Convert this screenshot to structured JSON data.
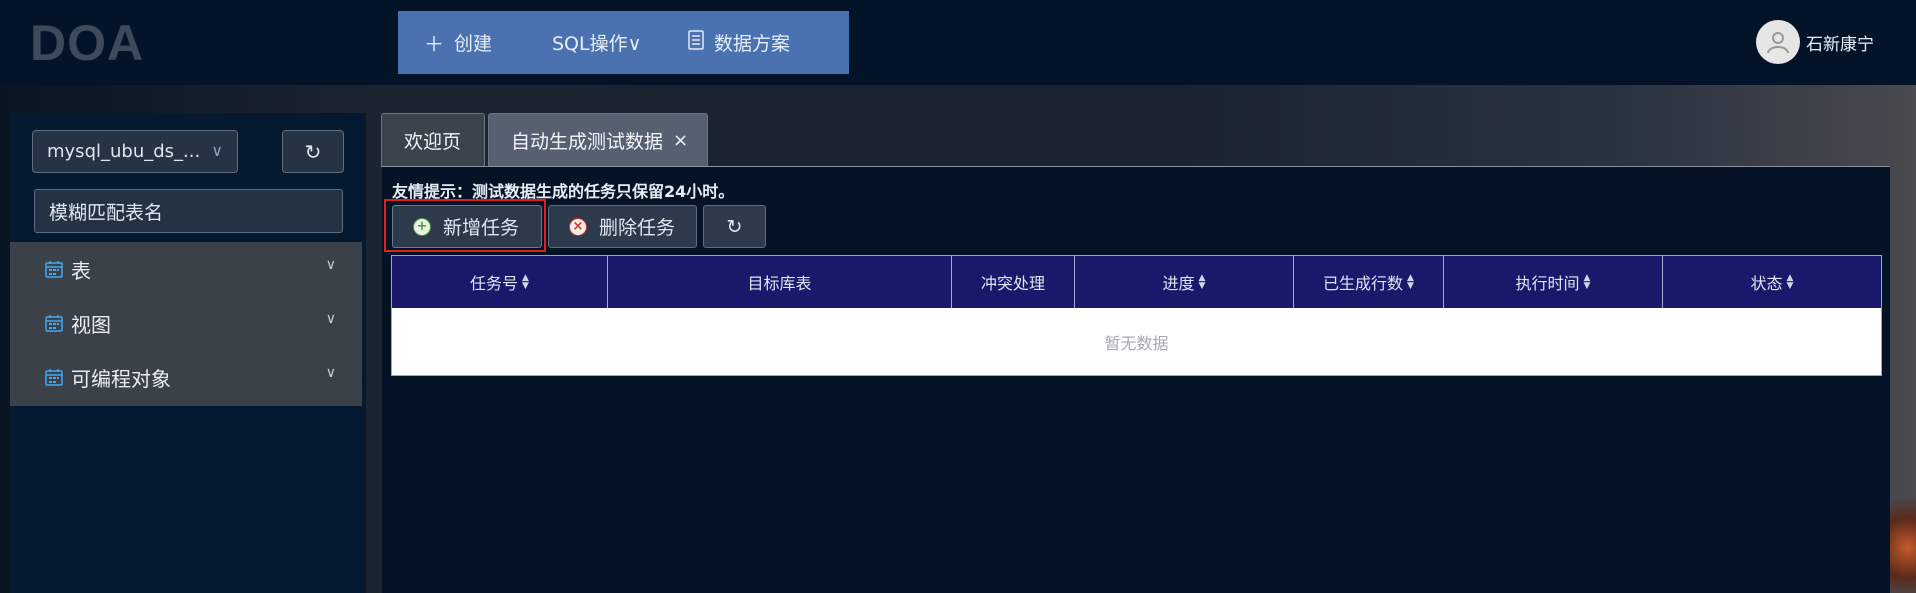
{
  "header": {
    "logo": "DOA",
    "nav": [
      {
        "label": "创建",
        "icon": "plus-icon"
      },
      {
        "label": "SQL操作∨",
        "icon": ""
      },
      {
        "label": "数据方案",
        "icon": "document-icon"
      }
    ],
    "user": {
      "name": "石新康宁",
      "icon": "user-avatar-icon"
    }
  },
  "sidebar": {
    "db_select": {
      "value": "mysql_ubu_ds_..."
    },
    "filter_placeholder": "模糊匹配表名",
    "tree": [
      {
        "label": "表",
        "icon": "calendar-icon"
      },
      {
        "label": "视图",
        "icon": "calendar-icon"
      },
      {
        "label": "可编程对象",
        "icon": "calendar-icon"
      }
    ]
  },
  "tabs": [
    {
      "label": "欢迎页"
    },
    {
      "label": "自动生成测试数据"
    }
  ],
  "main": {
    "tip": "友情提示：测试数据生成的任务只保留24小时。",
    "add_button": "新增任务",
    "delete_button": "删除任务",
    "table": {
      "columns": [
        "任务号",
        "目标库表",
        "冲突处理",
        "进度",
        "已生成行数",
        "执行时间",
        "状态"
      ],
      "empty_text": "暂无数据"
    }
  },
  "colors": {
    "header_bg": "#041428",
    "nav_bg": "#4a72b0",
    "table_header_bg": "#19186a",
    "highlight": "#e02020"
  }
}
